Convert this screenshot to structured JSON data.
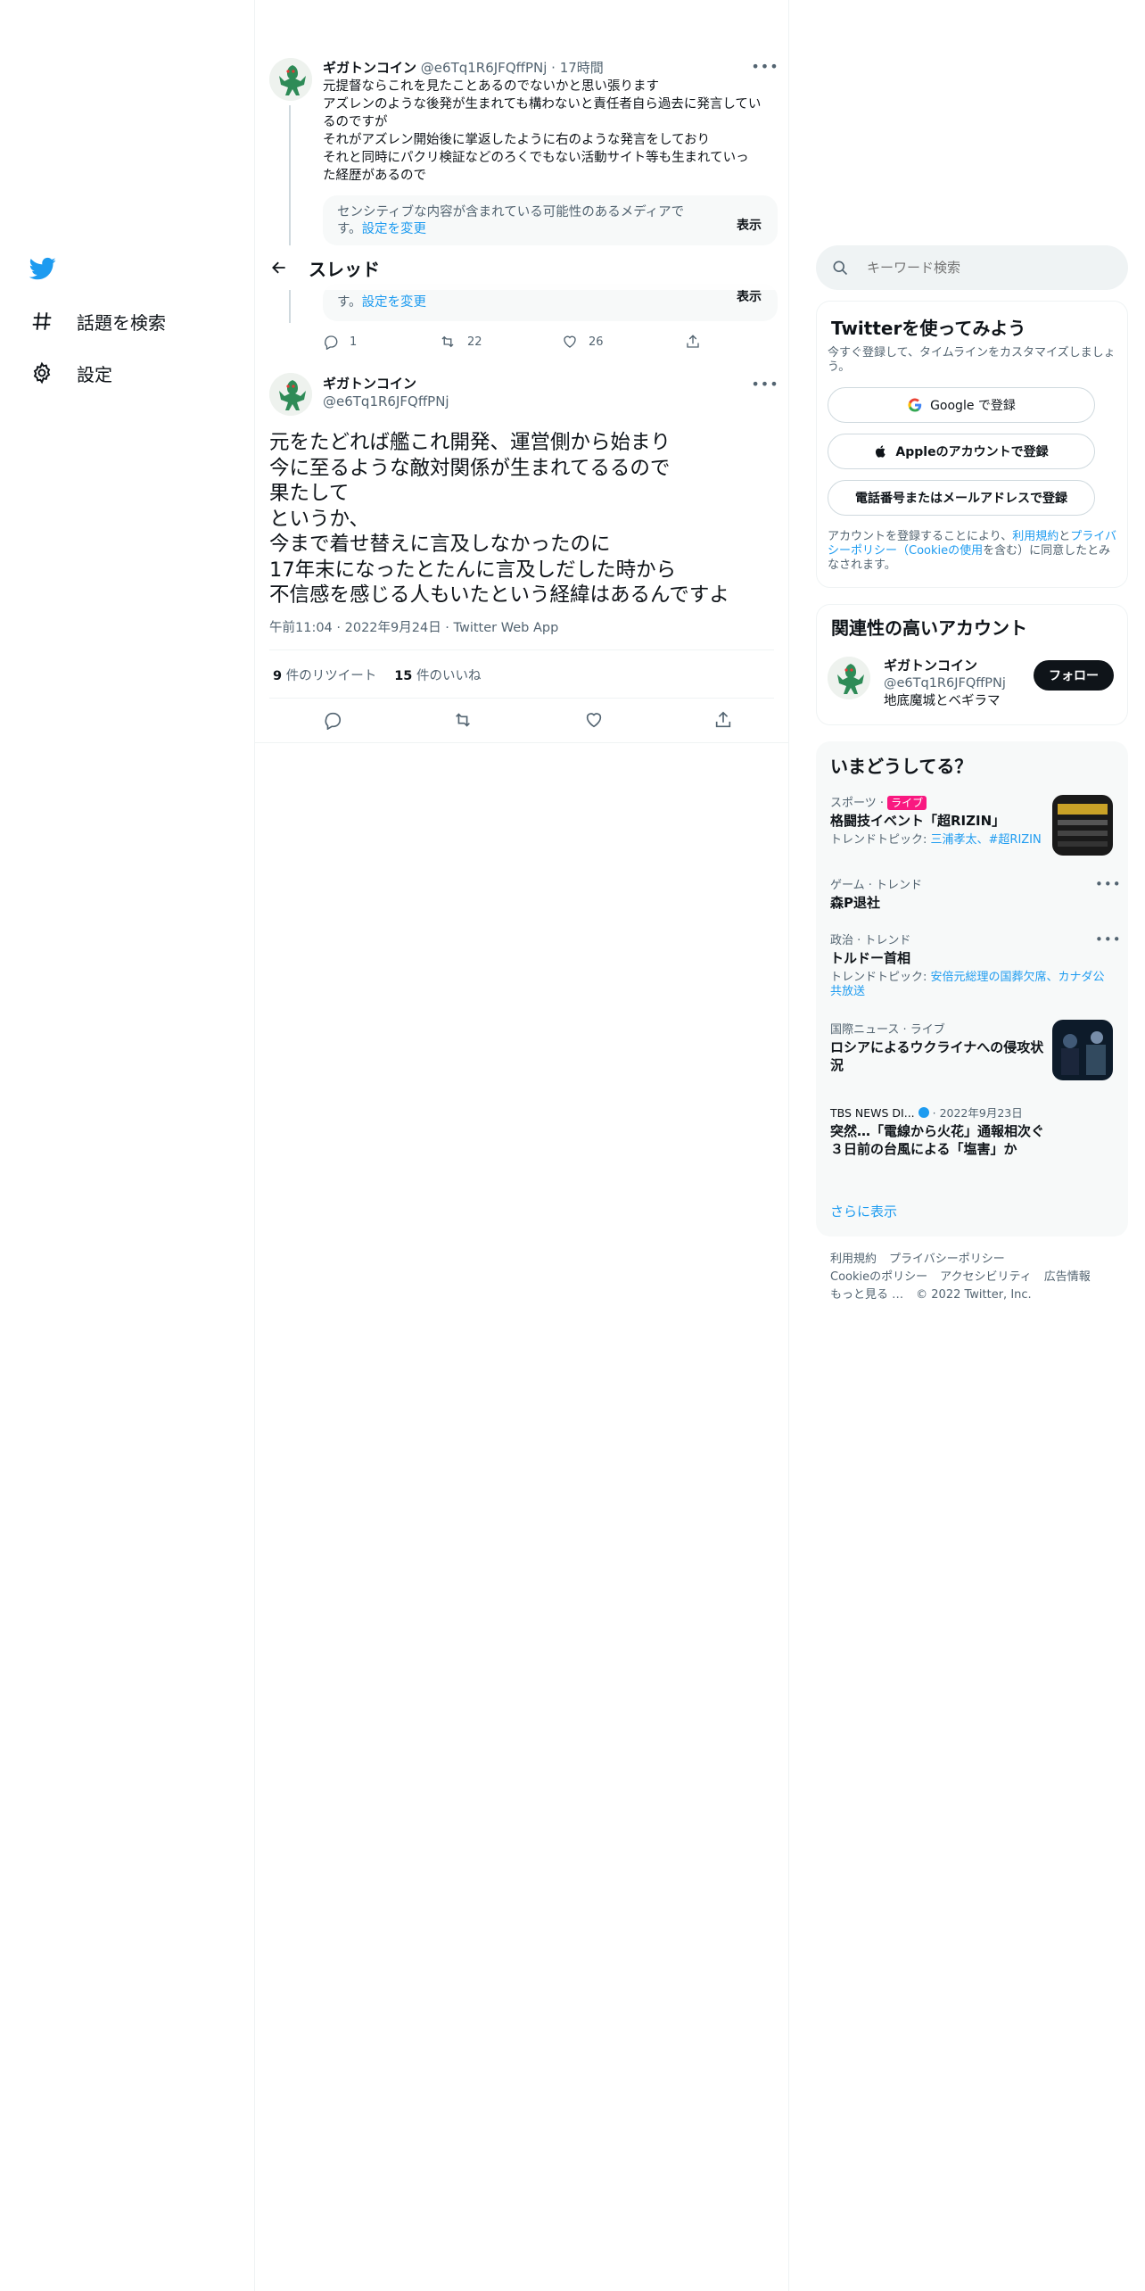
{
  "nav": {
    "explore_label": "話題を検索",
    "settings_label": "設定"
  },
  "header": {
    "title": "スレッド"
  },
  "parent_tweet": {
    "name": "ギガトンコイン",
    "handle": "@e6Tq1R6JFQffPNj",
    "time": "· 17時間",
    "lines": [
      "元提督ならこれを見たことあるのでないかと思い張ります",
      "アズレンのような後発が生まれても構わないと責任者自ら過去に発言してい",
      "るのですが",
      "それがアズレン開始後に掌返したように右のような発言をしており",
      "それと同時にパクリ検証などのろくでもない活動サイト等も生まれていっ",
      "た経歴があるので"
    ],
    "sensitive_text": "センシティブな内容が含まれている可能性のあるメディアで",
    "sensitive_text2": "す。",
    "sensitive_link": "設定を変更",
    "show_label": "表示",
    "reply_count": "1",
    "retweet_count": "22",
    "like_count": "26"
  },
  "main_tweet": {
    "name": "ギガトンコイン",
    "handle": "@e6Tq1R6JFQffPNj",
    "text": "元をたどれば艦これ開発、運営側から始まり\n今に至るような敵対関係が生まれてるるので\n果たして\nというか、\n今まで着せ替えに言及しなかったのに\n17年末になったとたんに言及しだした時から\n不信感を感じる人もいたという経緯はあるんですよ",
    "time": "午前11:04 · 2022年9月24日 · Twitter Web App",
    "retweets_num": "9",
    "retweets_label": "件のリツイート",
    "likes_num": "15",
    "likes_label": "件のいいね"
  },
  "search": {
    "placeholder": "キーワード検索"
  },
  "signup": {
    "title": "Twitterを使ってみよう",
    "subtitle": "今すぐ登録して、タイムラインをカスタマイズしましょう。",
    "google_label": "Google で登録",
    "apple_label": "Appleのアカウントで登録",
    "phone_label": "電話番号またはメールアドレスで登録",
    "legal_pre": "アカウントを登録することにより、",
    "legal_terms": "利用規約",
    "legal_and": "と",
    "legal_privacy": "プライバシーポリシー（Cookieの使用",
    "legal_post": "を含む）に同意したとみなされます。"
  },
  "related": {
    "title": "関連性の高いアカウント",
    "name": "ギガトンコイン",
    "handle": "@e6Tq1R6JFQffPNj",
    "bio": "地底魔城とベギラマ",
    "follow_label": "フォロー"
  },
  "trends": {
    "title": "いまどうしてる？",
    "items": [
      {
        "category": "スポーツ · ",
        "live": "ライブ",
        "title": "格闘技イベント「超RIZIN」",
        "topics_label": "トレンドトピック: ",
        "topics": "三浦孝太、#超RIZIN"
      },
      {
        "category": "ゲーム · トレンド",
        "title": "森P退社"
      },
      {
        "category": "政治 · トレンド",
        "title": "トルドー首相",
        "topics_label": "トレンドトピック: ",
        "topics": "安倍元総理の国葬欠席、カナダ公共放送"
      },
      {
        "category": "国際ニュース · ライブ",
        "title": "ロシアによるウクライナへの侵攻状況"
      },
      {
        "category": "TBS NEWS DI...",
        "date": "· 2022年9月23日",
        "title": "突然…「電線から火花」通報相次ぐ　３日前の台風による「塩害」か"
      }
    ],
    "show_more": "さらに表示"
  },
  "footer": {
    "terms": "利用規約",
    "privacy": "プライバシーポリシー",
    "cookie": "Cookieのポリシー",
    "accessibility": "アクセシビリティ",
    "ads": "広告情報",
    "more": "もっと見る …",
    "copyright": "© 2022 Twitter, Inc."
  },
  "colors": {
    "accent": "#1d9bf0",
    "text": "#0f1419",
    "muted": "#536471",
    "live": "#f91880"
  }
}
